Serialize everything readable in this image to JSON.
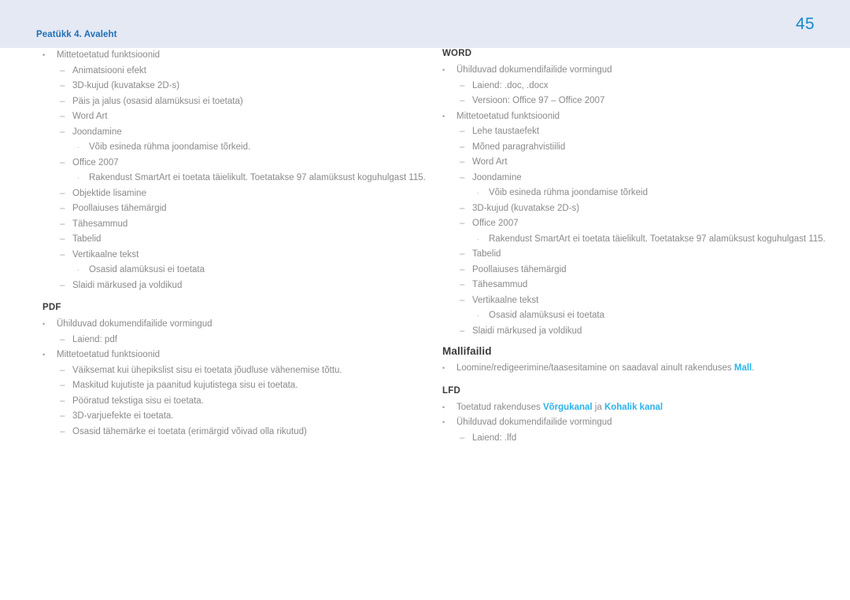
{
  "header": {
    "chapter": "Peatükk 4. Avaleht",
    "page_number": "45",
    "band_color": "#e4e9f4",
    "chapter_color": "#1f6fb5",
    "page_number_color": "#1787c8"
  },
  "colors": {
    "body_text": "#8a8a8a",
    "heading_text": "#3b3b3b",
    "link": "#2bb3ea"
  },
  "markers": {
    "level1": "•",
    "level2": "–",
    "level3": "·"
  },
  "left_column": {
    "blocks": [
      {
        "heading": null,
        "items": [
          {
            "level": 1,
            "text": "Mittetoetatud funktsioonid"
          },
          {
            "level": 2,
            "text": "Animatsiooni efekt"
          },
          {
            "level": 2,
            "text": "3D-kujud (kuvatakse 2D-s)"
          },
          {
            "level": 2,
            "text": "Päis ja jalus (osasid alamüksusi ei toetata)"
          },
          {
            "level": 2,
            "text": "Word Art"
          },
          {
            "level": 2,
            "text": "Joondamine"
          },
          {
            "level": 3,
            "text": "Võib esineda rühma joondamise tõrkeid."
          },
          {
            "level": 2,
            "text": "Office 2007"
          },
          {
            "level": 3,
            "text": "Rakendust SmartArt ei toetata täielikult. Toetatakse 97 alamüksust koguhulgast 115."
          },
          {
            "level": 2,
            "text": "Objektide lisamine"
          },
          {
            "level": 2,
            "text": "Poollaiuses tähemärgid"
          },
          {
            "level": 2,
            "text": "Tähesammud"
          },
          {
            "level": 2,
            "text": "Tabelid"
          },
          {
            "level": 2,
            "text": "Vertikaalne tekst"
          },
          {
            "level": 3,
            "text": "Osasid alamüksusi ei toetata"
          },
          {
            "level": 2,
            "text": "Slaidi märkused ja voldikud"
          }
        ]
      },
      {
        "heading": "PDF",
        "heading_size": "small",
        "items": [
          {
            "level": 1,
            "text": "Ühilduvad dokumendifailide vormingud"
          },
          {
            "level": 2,
            "text": "Laiend: pdf"
          },
          {
            "level": 1,
            "text": "Mittetoetatud funktsioonid"
          },
          {
            "level": 2,
            "text": "Väiksemat kui ühepikslist sisu ei toetata jõudluse vähenemise tõttu."
          },
          {
            "level": 2,
            "text": "Maskitud kujutiste ja paanitud kujutistega sisu ei toetata."
          },
          {
            "level": 2,
            "text": "Pööratud tekstiga sisu ei toetata."
          },
          {
            "level": 2,
            "text": "3D-varjuefekte ei toetata."
          },
          {
            "level": 2,
            "text": "Osasid tähemärke ei toetata (erimärgid võivad olla rikutud)"
          }
        ]
      }
    ]
  },
  "right_column": {
    "blocks": [
      {
        "heading": "WORD",
        "heading_size": "small",
        "items": [
          {
            "level": 1,
            "text": "Ühilduvad dokumendifailide vormingud"
          },
          {
            "level": 2,
            "text": "Laiend: .doc, .docx"
          },
          {
            "level": 2,
            "text": "Versioon: Office 97 – Office 2007"
          },
          {
            "level": 1,
            "text": "Mittetoetatud funktsioonid"
          },
          {
            "level": 2,
            "text": "Lehe taustaefekt"
          },
          {
            "level": 2,
            "text": "Mõned paragrahvistiilid"
          },
          {
            "level": 2,
            "text": "Word Art"
          },
          {
            "level": 2,
            "text": "Joondamine"
          },
          {
            "level": 3,
            "text": "Võib esineda rühma joondamise tõrkeid"
          },
          {
            "level": 2,
            "text": "3D-kujud (kuvatakse 2D-s)"
          },
          {
            "level": 2,
            "text": "Office 2007"
          },
          {
            "level": 3,
            "text": "Rakendust SmartArt ei toetata täielikult. Toetatakse 97 alamüksust koguhulgast 115."
          },
          {
            "level": 2,
            "text": "Tabelid"
          },
          {
            "level": 2,
            "text": "Poollaiuses tähemärgid"
          },
          {
            "level": 2,
            "text": "Tähesammud"
          },
          {
            "level": 2,
            "text": "Vertikaalne tekst"
          },
          {
            "level": 3,
            "text": "Osasid alamüksusi ei toetata"
          },
          {
            "level": 2,
            "text": "Slaidi märkused ja voldikud"
          }
        ]
      },
      {
        "heading": "Mallifailid",
        "heading_size": "big",
        "items": [
          {
            "level": 1,
            "segments": [
              {
                "text": "Loomine/redigeerimine/taasesitamine on saadaval ainult rakenduses ",
                "link": false
              },
              {
                "text": "Mall",
                "link": true
              },
              {
                "text": ".",
                "link": false
              }
            ]
          }
        ]
      },
      {
        "heading": "LFD",
        "heading_size": "small",
        "items": [
          {
            "level": 1,
            "segments": [
              {
                "text": "Toetatud rakenduses ",
                "link": false
              },
              {
                "text": "Võrgukanal",
                "link": true
              },
              {
                "text": " ja ",
                "link": false
              },
              {
                "text": "Kohalik kanal",
                "link": true
              }
            ]
          },
          {
            "level": 1,
            "text": "Ühilduvad dokumendifailide vormingud"
          },
          {
            "level": 2,
            "text": "Laiend: .lfd"
          }
        ]
      }
    ]
  }
}
